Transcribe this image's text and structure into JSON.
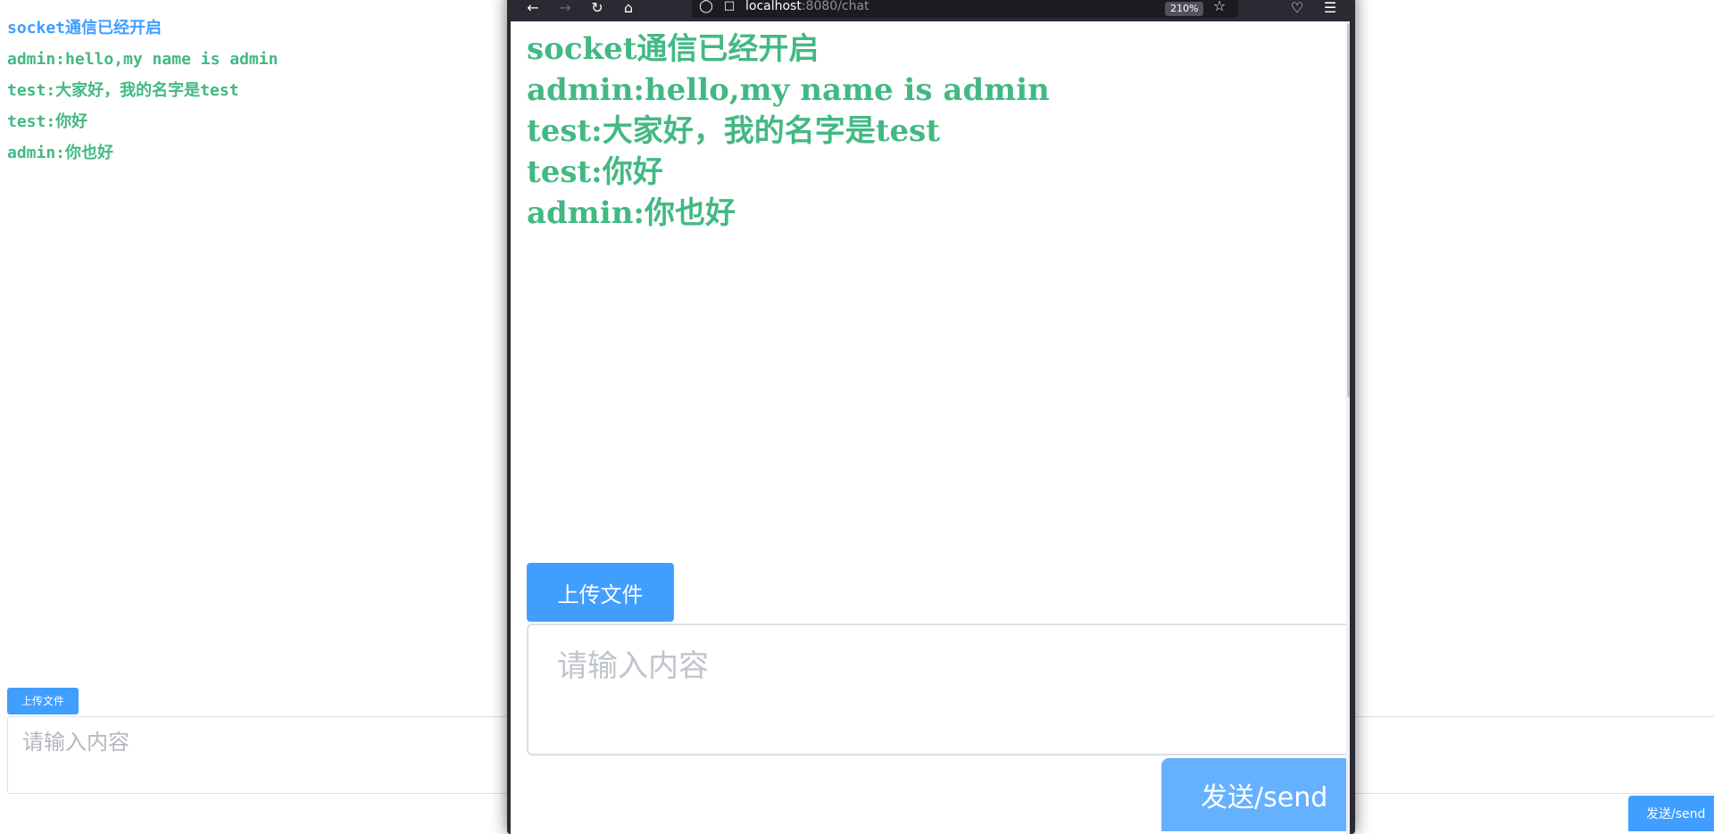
{
  "background_page": {
    "messages": [
      {
        "text": "socket通信已经开启",
        "type": "status"
      },
      {
        "text": "admin:hello,my name is admin",
        "type": "chat"
      },
      {
        "text": "test:大家好，我的名字是test",
        "type": "chat"
      },
      {
        "text": "test:你好",
        "type": "chat"
      },
      {
        "text": "admin:你也好",
        "type": "chat"
      }
    ],
    "upload_label": "上传文件",
    "input_placeholder": "请输入内容",
    "input_value": "",
    "send_label": "发送/send"
  },
  "browser": {
    "url_host": "localhost",
    "url_path": ":8080/chat",
    "zoom": "210%",
    "icons": {
      "back": "back-arrow-icon",
      "forward": "forward-arrow-icon",
      "reload": "reload-icon",
      "home": "home-icon",
      "shield": "tracking-shield-icon",
      "page": "page-icon",
      "bookmark": "bookmark-star-icon",
      "pocket": "pocket-icon",
      "menu": "hamburger-menu-icon"
    },
    "page": {
      "messages": [
        {
          "text": "socket通信已经开启"
        },
        {
          "text": "admin:hello,my name is admin"
        },
        {
          "text": "test:大家好，我的名字是test"
        },
        {
          "text": "test:你好"
        },
        {
          "text": "admin:你也好"
        }
      ],
      "upload_label": "上传文件",
      "input_placeholder": "请输入内容",
      "input_value": "",
      "send_label": "发送/send"
    }
  },
  "colors": {
    "status_text": "#409eff",
    "chat_text": "#42b983",
    "primary_button": "#409eff",
    "send_button_overlay": "#66b1ff"
  }
}
